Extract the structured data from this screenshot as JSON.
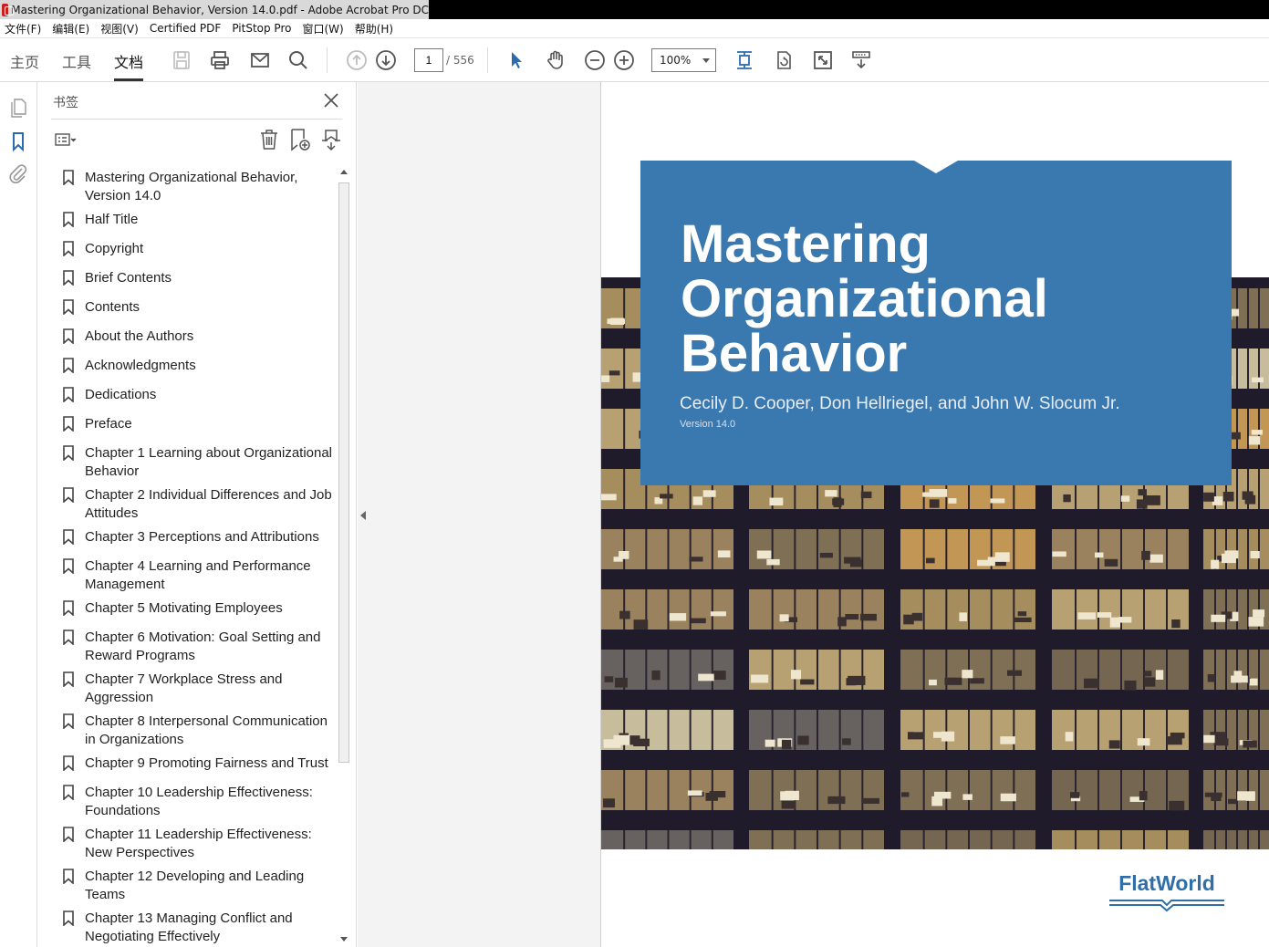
{
  "window": {
    "title": "Mastering Organizational Behavior, Version 14.0.pdf - Adobe Acrobat Pro DC"
  },
  "menu": [
    "文件(F)",
    "编辑(E)",
    "视图(V)",
    "Certified PDF",
    "PitStop Pro",
    "窗口(W)",
    "帮助(H)"
  ],
  "tabs": {
    "home": "主页",
    "tools": "工具",
    "document": "文档"
  },
  "navigation": {
    "current_page": "1",
    "total_pages": "/ 556",
    "zoom": "100%"
  },
  "bookmarks_panel": {
    "title": "书签",
    "items": [
      "Mastering Organizational Behavior, Version 14.0",
      "Half Title",
      "Copyright",
      "Brief Contents",
      "Contents",
      "About the Authors",
      "Acknowledgments",
      "Dedications",
      "Preface",
      "Chapter 1 Learning about Organizational Behavior",
      "Chapter 2 Individual Differences and Job Attitudes",
      "Chapter 3 Perceptions and Attributions",
      "Chapter 4 Learning and Performance Management",
      "Chapter 5 Motivating Employees",
      "Chapter 6 Motivation: Goal Setting and Reward Programs",
      "Chapter 7 Workplace Stress and Aggression",
      "Chapter 8 Interpersonal Communication in Organizations",
      "Chapter 9 Promoting Fairness and Trust",
      "Chapter 10 Leadership Effectiveness: Foundations",
      "Chapter 11 Leadership Effectiveness: New Perspectives",
      "Chapter 12 Developing and Leading Teams",
      "Chapter 13 Managing Conflict and Negotiating Effectively"
    ]
  },
  "cover": {
    "title_lines": [
      "Mastering",
      "Organizational",
      "Behavior"
    ],
    "authors": "Cecily D. Cooper, Don Hellriegel, and John W. Slocum Jr.",
    "version": "Version 14.0",
    "publisher": "FlatWorld"
  },
  "colors": {
    "banner": "#3a78b0",
    "accent": "#2b6cb0",
    "building": "#201b2a"
  }
}
